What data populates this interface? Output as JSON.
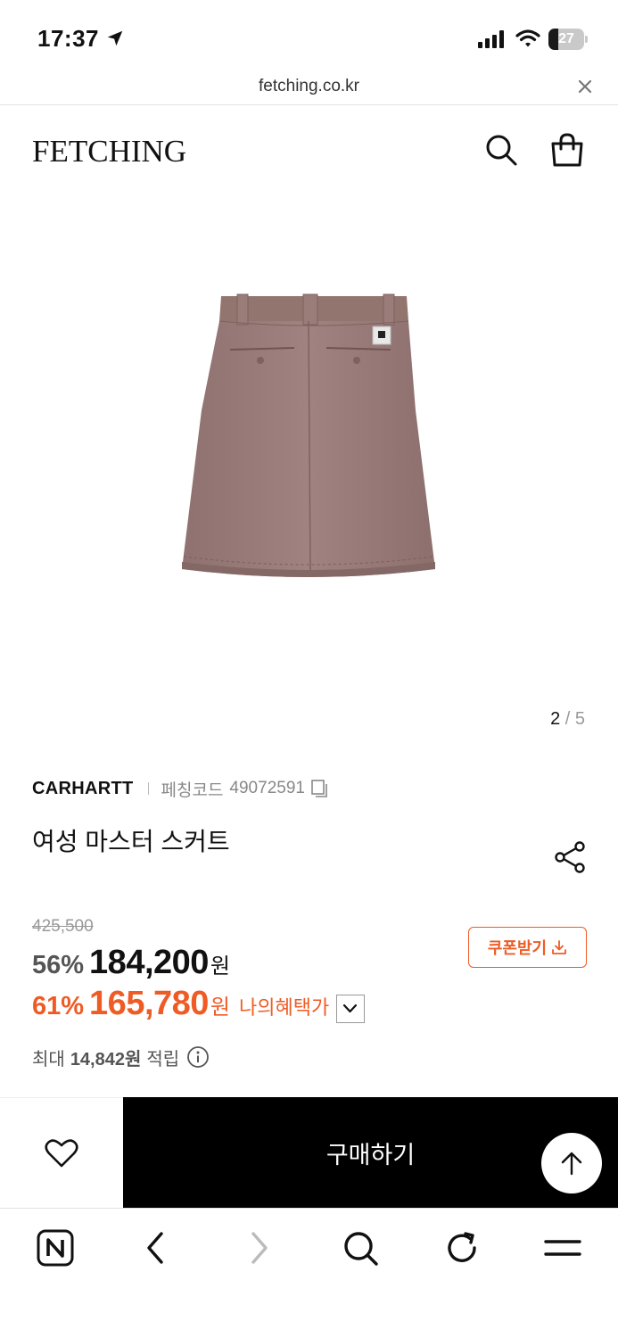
{
  "status_bar": {
    "time": "17:37",
    "battery": "27",
    "battery_level": 0.27
  },
  "browser": {
    "url": "fetching.co.kr"
  },
  "header": {
    "logo": "FETCHING"
  },
  "gallery": {
    "current": "2",
    "separator": "/",
    "total": "5"
  },
  "product": {
    "brand": "CARHARTT",
    "code_label": "페칭코드",
    "code": "49072591",
    "name": "여성 마스터 스커트",
    "original_price": "425,500",
    "discount_rate": "56%",
    "sale_price": "184,200",
    "currency": "원",
    "my_discount_rate": "61%",
    "my_price": "165,780",
    "my_price_label": "나의혜택가",
    "coupon_label": "쿠폰받기",
    "points_prefix": "최대",
    "points_value": "14,842원",
    "points_suffix": "적립"
  },
  "cta": {
    "buy_label": "구매하기"
  },
  "colors": {
    "accent": "#ef5b25",
    "product": "#9b7b79",
    "cta_bg": "#000000"
  },
  "icons": [
    "location-arrow-icon",
    "signal-icon",
    "wifi-icon",
    "battery-icon",
    "close-icon",
    "search-icon",
    "shopping-bag-icon",
    "copy-icon",
    "share-icon",
    "chevron-down-icon",
    "download-icon",
    "info-icon",
    "heart-icon",
    "arrow-up-icon",
    "naver-icon",
    "back-icon",
    "forward-icon",
    "refresh-icon",
    "menu-icon"
  ]
}
